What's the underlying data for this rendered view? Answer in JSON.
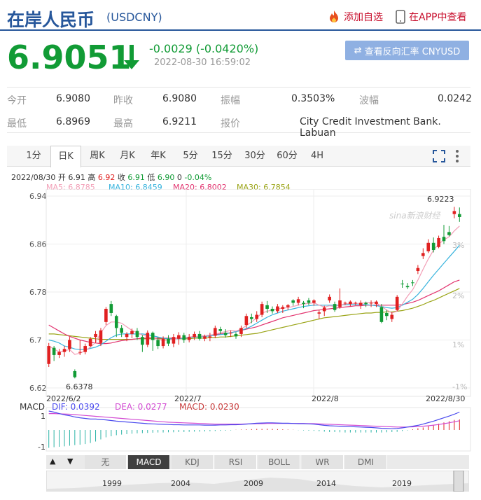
{
  "header": {
    "title": "在岸人民币",
    "code": "(USDCNY)",
    "fav_label": "添加自选",
    "app_label": "在APP中查看"
  },
  "quote": {
    "price": "6.9051",
    "change": "-0.0029 (-0.0420%)",
    "time": "2022-08-30 16:59:02",
    "reverse_button": "查看反向汇率 CNYUSD"
  },
  "stats": {
    "open_label": "今开",
    "open_value": "6.9080",
    "prev_label": "昨收",
    "prev_value": "6.9080",
    "amp_label": "振幅",
    "amp_value": "0.3503%",
    "wave_label": "波幅",
    "wave_value": "0.0242",
    "low_label": "最低",
    "low_value": "6.8969",
    "high_label": "最高",
    "high_value": "6.9211",
    "source_label": "报价",
    "source_value": "City Credit Investment Bank. Labuan"
  },
  "tabs": [
    "1分",
    "日K",
    "周K",
    "月K",
    "年K",
    "5分",
    "15分",
    "30分",
    "60分",
    "4H"
  ],
  "indicators": {
    "date": "2022/08/30",
    "open_label": "开",
    "open": "6.91",
    "high_label": "高",
    "high": "6.92",
    "close_label": "收",
    "close": "6.91",
    "low_label": "低",
    "low": "6.90",
    "zero": "0",
    "pct": "-0.04%",
    "ma5": "MA5: 6.8785",
    "ma10": "MA10: 6.8459",
    "ma20": "MA20: 6.8002",
    "ma30": "MA30: 6.7854",
    "macd_label": "MACD",
    "dif": "DIF: 0.0392",
    "dea": "DEA: 0.0277",
    "macd": "MACD: 0.0230"
  },
  "colors": {
    "up": "#e02020",
    "down": "#119b35",
    "ma5": "#f29eb6",
    "ma10": "#37b3dd",
    "ma20": "#e2336f",
    "ma30": "#9aa416"
  },
  "chart_data": {
    "type": "candlestick",
    "y_ticks": [
      "6.94",
      "6.86",
      "6.78",
      "6.7",
      "6.62"
    ],
    "pct_ticks": [
      "3%",
      "2%",
      "1%",
      "-1%"
    ],
    "x_ticks": [
      "2022/6/2",
      "2022/7",
      "2022/8",
      "2022/8/30"
    ],
    "max_label": "6.9223",
    "min_label": "6.6378",
    "ylim": [
      6.62,
      6.94
    ],
    "candles": [
      [
        6.66,
        6.69,
        6.695,
        6.655
      ],
      [
        6.687,
        6.675,
        6.69,
        6.665
      ],
      [
        6.675,
        6.68,
        6.685,
        6.67
      ],
      [
        6.68,
        6.685,
        6.69,
        6.672
      ],
      [
        6.685,
        6.7,
        6.705,
        6.68
      ],
      [
        6.648,
        6.638,
        6.651,
        6.636
      ],
      [
        6.68,
        6.68,
        6.7,
        6.675
      ],
      [
        6.68,
        6.69,
        6.694,
        6.676
      ],
      [
        6.69,
        6.702,
        6.705,
        6.688
      ],
      [
        6.705,
        6.71,
        6.715,
        6.695
      ],
      [
        6.695,
        6.716,
        6.72,
        6.69
      ],
      [
        6.73,
        6.752,
        6.755,
        6.725
      ],
      [
        6.76,
        6.745,
        6.765,
        6.74
      ],
      [
        6.74,
        6.72,
        6.742,
        6.705
      ],
      [
        6.72,
        6.712,
        6.725,
        6.705
      ],
      [
        6.705,
        6.71,
        6.713,
        6.698
      ],
      [
        6.71,
        6.715,
        6.719,
        6.703
      ],
      [
        6.715,
        6.705,
        6.72,
        6.7
      ],
      [
        6.705,
        6.692,
        6.708,
        6.68
      ],
      [
        6.692,
        6.712,
        6.716,
        6.688
      ],
      [
        6.712,
        6.7,
        6.714,
        6.682
      ],
      [
        6.7,
        6.69,
        6.705,
        6.685
      ],
      [
        6.69,
        6.702,
        6.706,
        6.686
      ],
      [
        6.702,
        6.694,
        6.708,
        6.69
      ],
      [
        6.694,
        6.705,
        6.71,
        6.688
      ],
      [
        6.702,
        6.708,
        6.713,
        6.692
      ],
      [
        6.708,
        6.7,
        6.712,
        6.695
      ],
      [
        6.7,
        6.705,
        6.71,
        6.696
      ],
      [
        6.705,
        6.71,
        6.714,
        6.7
      ],
      [
        6.71,
        6.702,
        6.715,
        6.699
      ],
      [
        6.702,
        6.706,
        6.709,
        6.698
      ],
      [
        6.704,
        6.706,
        6.712,
        6.698
      ],
      [
        6.707,
        6.72,
        6.724,
        6.703
      ],
      [
        6.718,
        6.715,
        6.722,
        6.71
      ],
      [
        6.712,
        6.708,
        6.718,
        6.704
      ],
      [
        6.712,
        6.712,
        6.716,
        6.705
      ],
      [
        6.71,
        6.706,
        6.713,
        6.702
      ],
      [
        6.71,
        6.72,
        6.724,
        6.705
      ],
      [
        6.725,
        6.74,
        6.744,
        6.72
      ],
      [
        6.738,
        6.735,
        6.744,
        6.728
      ],
      [
        6.735,
        6.742,
        6.748,
        6.73
      ],
      [
        6.742,
        6.76,
        6.764,
        6.738
      ],
      [
        6.758,
        6.752,
        6.765,
        6.745
      ],
      [
        6.752,
        6.748,
        6.756,
        6.744
      ],
      [
        6.748,
        6.756,
        6.76,
        6.745
      ],
      [
        6.752,
        6.755,
        6.758,
        6.745
      ],
      [
        6.755,
        6.758,
        6.76,
        6.75
      ],
      [
        6.766,
        6.762,
        6.768,
        6.757
      ],
      [
        6.762,
        6.768,
        6.772,
        6.758
      ],
      [
        6.762,
        6.76,
        6.765,
        6.753
      ],
      [
        6.766,
        6.762,
        6.77,
        6.758
      ],
      [
        6.762,
        6.766,
        6.768,
        6.757
      ],
      [
        6.744,
        6.746,
        6.75,
        6.735
      ],
      [
        6.748,
        6.754,
        6.757,
        6.74
      ],
      [
        6.766,
        6.772,
        6.776,
        6.762
      ],
      [
        6.76,
        6.75,
        6.764,
        6.747
      ],
      [
        6.755,
        6.766,
        6.786,
        6.752
      ],
      [
        6.762,
        6.762,
        6.764,
        6.758
      ],
      [
        6.76,
        6.764,
        6.766,
        6.756
      ],
      [
        6.762,
        6.762,
        6.764,
        6.758
      ],
      [
        6.758,
        6.762,
        6.766,
        6.752
      ],
      [
        6.762,
        6.76,
        6.764,
        6.755
      ],
      [
        6.762,
        6.762,
        6.766,
        6.755
      ],
      [
        6.76,
        6.764,
        6.766,
        6.755
      ],
      [
        6.755,
        6.73,
        6.76,
        6.728
      ],
      [
        6.745,
        6.74,
        6.75,
        6.733
      ],
      [
        6.735,
        6.742,
        6.746,
        6.73
      ],
      [
        6.75,
        6.772,
        6.775,
        6.748
      ],
      [
        6.794,
        6.793,
        6.8,
        6.787
      ],
      [
        6.79,
        6.788,
        6.795,
        6.785
      ],
      [
        6.796,
        6.795,
        6.8,
        6.79
      ],
      [
        6.815,
        6.82,
        6.825,
        6.81
      ],
      [
        6.84,
        6.845,
        6.853,
        6.835
      ],
      [
        6.848,
        6.862,
        6.868,
        6.845
      ],
      [
        6.862,
        6.85,
        6.871,
        6.846
      ],
      [
        6.855,
        6.87,
        6.874,
        6.853
      ],
      [
        6.872,
        6.865,
        6.892,
        6.86
      ],
      [
        6.88,
        6.875,
        6.89,
        6.873
      ],
      [
        6.91,
        6.915,
        6.922,
        6.903
      ],
      [
        6.91,
        6.905,
        6.921,
        6.897
      ]
    ],
    "ma5": [
      6.69,
      6.685,
      6.68,
      6.682,
      6.684,
      6.676,
      6.678,
      6.682,
      6.688,
      6.696,
      6.712,
      6.724,
      6.73,
      6.73,
      6.728,
      6.722,
      6.716,
      6.712,
      6.708,
      6.706,
      6.703,
      6.701,
      6.699,
      6.7,
      6.701,
      6.703,
      6.704,
      6.705,
      6.706,
      6.706,
      6.707,
      6.708,
      6.71,
      6.712,
      6.714,
      6.716,
      6.715,
      6.718,
      6.724,
      6.73,
      6.737,
      6.745,
      6.748,
      6.75,
      6.752,
      6.753,
      6.754,
      6.756,
      6.758,
      6.76,
      6.761,
      6.762,
      6.758,
      6.755,
      6.757,
      6.756,
      6.758,
      6.76,
      6.761,
      6.761,
      6.761,
      6.762,
      6.762,
      6.762,
      6.756,
      6.75,
      6.745,
      6.748,
      6.76,
      6.773,
      6.784,
      6.8,
      6.818,
      6.835,
      6.85,
      6.86,
      6.867,
      6.872,
      6.882,
      6.89
    ],
    "ma10": [
      6.7,
      6.698,
      6.695,
      6.69,
      6.688,
      6.685,
      6.684,
      6.684,
      6.686,
      6.688,
      6.692,
      6.698,
      6.704,
      6.708,
      6.71,
      6.71,
      6.71,
      6.71,
      6.71,
      6.709,
      6.707,
      6.705,
      6.703,
      6.702,
      6.702,
      6.702,
      6.703,
      6.704,
      6.705,
      6.705,
      6.706,
      6.707,
      6.708,
      6.709,
      6.71,
      6.712,
      6.714,
      6.716,
      6.719,
      6.723,
      6.728,
      6.733,
      6.738,
      6.742,
      6.745,
      6.748,
      6.75,
      6.752,
      6.754,
      6.756,
      6.757,
      6.758,
      6.758,
      6.758,
      6.758,
      6.758,
      6.758,
      6.759,
      6.759,
      6.759,
      6.759,
      6.759,
      6.758,
      6.757,
      6.756,
      6.754,
      6.753,
      6.754,
      6.758,
      6.763,
      6.768,
      6.776,
      6.786,
      6.797,
      6.808,
      6.818,
      6.828,
      6.838,
      6.848,
      6.858
    ],
    "ma20": [
      6.725,
      6.72,
      6.715,
      6.71,
      6.706,
      6.703,
      6.7,
      6.698,
      6.696,
      6.695,
      6.694,
      6.694,
      6.695,
      6.697,
      6.699,
      6.7,
      6.701,
      6.702,
      6.703,
      6.703,
      6.703,
      6.703,
      6.703,
      6.703,
      6.703,
      6.703,
      6.703,
      6.704,
      6.705,
      6.706,
      6.707,
      6.708,
      6.709,
      6.71,
      6.711,
      6.712,
      6.714,
      6.716,
      6.718,
      6.72,
      6.722,
      6.725,
      6.728,
      6.731,
      6.734,
      6.737,
      6.739,
      6.741,
      6.743,
      6.745,
      6.747,
      6.749,
      6.75,
      6.751,
      6.752,
      6.753,
      6.754,
      6.755,
      6.756,
      6.757,
      6.757,
      6.758,
      6.758,
      6.758,
      6.758,
      6.758,
      6.758,
      6.758,
      6.759,
      6.761,
      6.763,
      6.766,
      6.77,
      6.774,
      6.778,
      6.782,
      6.787,
      6.792,
      6.797,
      6.8
    ],
    "ma30": [
      6.71,
      6.71,
      6.709,
      6.708,
      6.707,
      6.706,
      6.705,
      6.704,
      6.703,
      6.702,
      6.701,
      6.701,
      6.701,
      6.701,
      6.701,
      6.701,
      6.701,
      6.702,
      6.702,
      6.702,
      6.702,
      6.702,
      6.702,
      6.702,
      6.702,
      6.702,
      6.702,
      6.702,
      6.703,
      6.703,
      6.703,
      6.704,
      6.704,
      6.705,
      6.705,
      6.706,
      6.707,
      6.708,
      6.709,
      6.71,
      6.711,
      6.713,
      6.715,
      6.717,
      6.719,
      6.721,
      6.723,
      6.725,
      6.727,
      6.729,
      6.731,
      6.733,
      6.735,
      6.737,
      6.738,
      6.739,
      6.74,
      6.741,
      6.742,
      6.743,
      6.744,
      6.745,
      6.745,
      6.746,
      6.746,
      6.747,
      6.747,
      6.748,
      6.749,
      6.751,
      6.753,
      6.756,
      6.759,
      6.763,
      6.766,
      6.77,
      6.774,
      6.778,
      6.782,
      6.786
    ],
    "dif": [
      0.9,
      0.85,
      0.78,
      0.72,
      0.68,
      0.62,
      0.58,
      0.55,
      0.52,
      0.52,
      0.5,
      0.48,
      0.45,
      0.42,
      0.4,
      0.38,
      0.36,
      0.34,
      0.32,
      0.3,
      0.29,
      0.28,
      0.27,
      0.26,
      0.25,
      0.25,
      0.24,
      0.24,
      0.24,
      0.24,
      0.23,
      0.23,
      0.23,
      0.24,
      0.24,
      0.25,
      0.25,
      0.26,
      0.28,
      0.3,
      0.32,
      0.33,
      0.34,
      0.34,
      0.33,
      0.32,
      0.32,
      0.31,
      0.3,
      0.3,
      0.29,
      0.28,
      0.25,
      0.22,
      0.2,
      0.19,
      0.18,
      0.17,
      0.16,
      0.15,
      0.14,
      0.13,
      0.12,
      0.1,
      0.08,
      0.07,
      0.06,
      0.07,
      0.1,
      0.14,
      0.18,
      0.22,
      0.28,
      0.35,
      0.42,
      0.5,
      0.58,
      0.66,
      0.75,
      0.85
    ],
    "dea": [
      0.78,
      0.78,
      0.77,
      0.76,
      0.75,
      0.73,
      0.71,
      0.69,
      0.67,
      0.65,
      0.63,
      0.61,
      0.59,
      0.57,
      0.55,
      0.53,
      0.51,
      0.49,
      0.47,
      0.45,
      0.43,
      0.41,
      0.39,
      0.37,
      0.36,
      0.35,
      0.34,
      0.33,
      0.32,
      0.31,
      0.3,
      0.29,
      0.28,
      0.28,
      0.28,
      0.28,
      0.28,
      0.28,
      0.29,
      0.29,
      0.3,
      0.3,
      0.31,
      0.31,
      0.31,
      0.31,
      0.31,
      0.31,
      0.31,
      0.31,
      0.3,
      0.3,
      0.29,
      0.28,
      0.27,
      0.26,
      0.25,
      0.24,
      0.23,
      0.22,
      0.21,
      0.2,
      0.19,
      0.18,
      0.17,
      0.16,
      0.15,
      0.14,
      0.14,
      0.14,
      0.15,
      0.16,
      0.18,
      0.2,
      0.23,
      0.26,
      0.3,
      0.34,
      0.39,
      0.44
    ],
    "macd_bars": [
      -0.85,
      -0.82,
      -0.8,
      -0.78,
      -0.75,
      -0.72,
      -0.7,
      -0.67,
      -0.62,
      -0.55,
      -0.45,
      -0.35,
      -0.3,
      -0.25,
      -0.22,
      -0.2,
      -0.18,
      -0.16,
      -0.15,
      -0.14,
      -0.13,
      -0.12,
      -0.12,
      -0.11,
      -0.11,
      -0.1,
      -0.1,
      -0.09,
      -0.08,
      -0.08,
      -0.07,
      -0.06,
      -0.05,
      -0.04,
      -0.03,
      -0.02,
      0.01,
      0.02,
      0.03,
      0.04,
      0.05,
      0.05,
      0.06,
      0.05,
      0.04,
      0.03,
      0.02,
      0.01,
      -0.01,
      -0.02,
      -0.03,
      -0.04,
      -0.06,
      -0.08,
      -0.1,
      -0.1,
      -0.11,
      -0.12,
      -0.12,
      -0.12,
      -0.12,
      -0.12,
      -0.12,
      -0.12,
      -0.12,
      -0.11,
      -0.1,
      -0.09,
      -0.05,
      -0.02,
      0.03,
      0.08,
      0.12,
      0.18,
      0.24,
      0.3,
      0.36,
      0.42,
      0.48,
      0.5
    ]
  },
  "bottom": {
    "tabs": [
      "无",
      "MACD",
      "KDJ",
      "RSI",
      "BOLL",
      "WR",
      "DMI"
    ],
    "years": [
      "1999",
      "2004",
      "2009",
      "2014",
      "2019"
    ]
  }
}
